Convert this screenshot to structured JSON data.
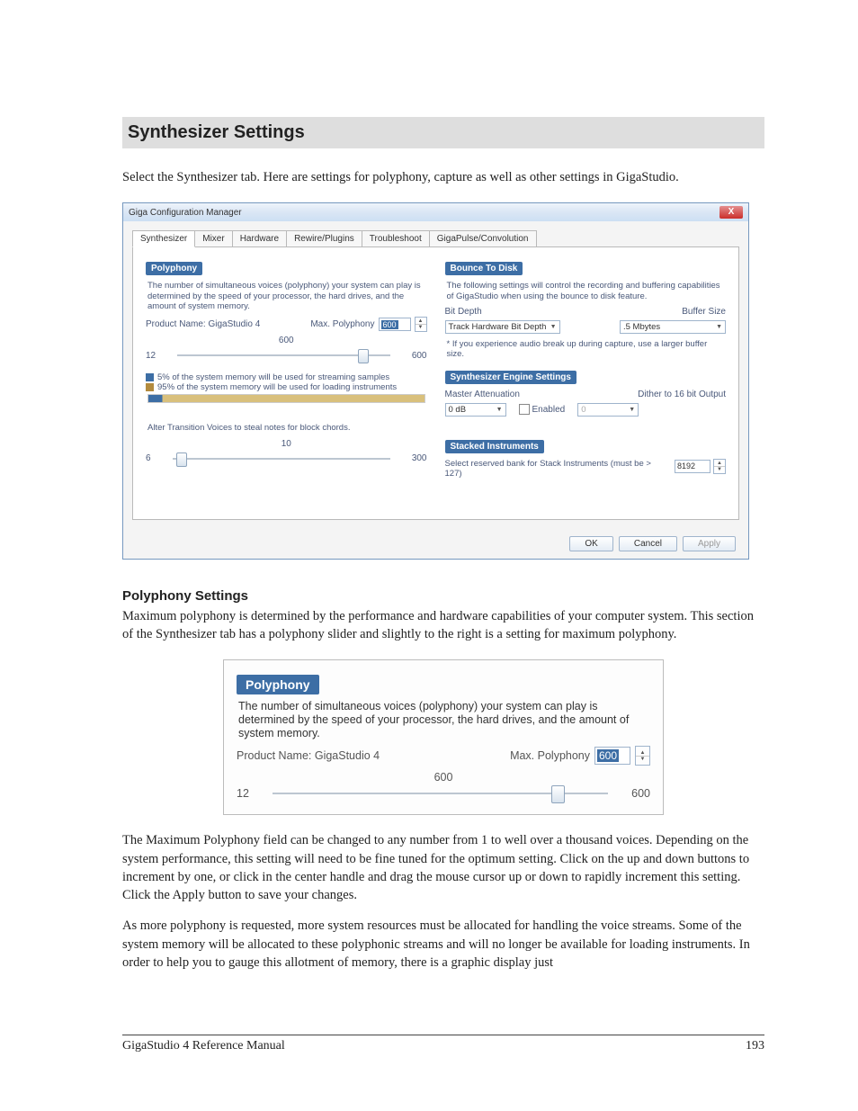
{
  "headings": {
    "title": "Synthesizer Settings",
    "subtitle": "Polyphony Settings"
  },
  "paragraphs": {
    "intro": "Select the Synthesizer tab. Here are settings for polyphony, capture as well as other settings in GigaStudio.",
    "poly1": "Maximum polyphony is determined by the performance and hardware capabilities of your computer system. This section of the Synthesizer tab has a polyphony slider and slightly to the right is a setting for maximum polyphony.",
    "poly2": "The Maximum Polyphony field can be changed to any number from 1 to well over a thousand voices. Depending on the system performance, this setting will need to be fine tuned for the optimum setting. Click on the up and down buttons to increment by one, or click in the center handle and drag the mouse cursor up or down to rapidly increment this setting. Click the Apply button to save your changes.",
    "poly3": "As more polyphony is requested, more system resources must be allocated for handling the voice streams. Some of the system memory will be allocated to these polyphonic streams and will no longer be available for loading instruments. In order to help you to gauge this allotment of memory, there is a graphic display just"
  },
  "dialog": {
    "title": "Giga Configuration Manager",
    "tabs": [
      "Synthesizer",
      "Mixer",
      "Hardware",
      "Rewire/Plugins",
      "Troubleshoot",
      "GigaPulse/Convolution"
    ],
    "polyphony": {
      "header": "Polyphony",
      "desc": "The number of simultaneous voices (polyphony) your system can play is determined by the speed of your processor, the hard drives, and the amount of system memory.",
      "product_name_label": "Product Name: GigaStudio 4",
      "max_poly_label": "Max. Polyphony",
      "max_poly_value": "600",
      "slider_center": "600",
      "slider_min": "12",
      "slider_max": "600",
      "legend1": "5% of the system memory will be used for streaming samples",
      "legend2": "95% of the system memory will be used for loading instruments",
      "subnote": "Alter Transition Voices to steal notes for block chords.",
      "tslider_center": "10",
      "tslider_min": "6",
      "tslider_max": "300"
    },
    "bounce": {
      "header": "Bounce To Disk",
      "desc": "The following settings will control the recording and buffering capabilities of GigaStudio when using the bounce to disk feature.",
      "bit_depth_label": "Bit Depth",
      "bit_depth_value": "Track Hardware Bit Depth",
      "buffer_label": "Buffer Size",
      "buffer_value": ".5 Mbytes",
      "note": "* If you experience audio break up during capture, use a larger buffer size."
    },
    "engine": {
      "header": "Synthesizer Engine Settings",
      "master_att_label": "Master Attenuation",
      "master_att_value": "0 dB",
      "dither_label": "Dither to 16 bit Output",
      "enabled_label": "Enabled",
      "dither_value": "0"
    },
    "stacked": {
      "header": "Stacked Instruments",
      "desc": "Select reserved bank for Stack Instruments (must be > 127)",
      "value": "8192"
    },
    "buttons": {
      "ok": "OK",
      "cancel": "Cancel",
      "apply": "Apply"
    }
  },
  "inset": {
    "header": "Polyphony",
    "desc": "The number of simultaneous voices (polyphony) your system can play is determined by the speed of your processor, the hard drives, and the amount of system memory.",
    "product_name_label": "Product Name: GigaStudio 4",
    "max_poly_label": "Max. Polyphony",
    "max_poly_value": "600",
    "slider_center": "600",
    "slider_min": "12",
    "slider_max": "600"
  },
  "footer": {
    "left": "GigaStudio 4 Reference Manual",
    "right": "193"
  }
}
